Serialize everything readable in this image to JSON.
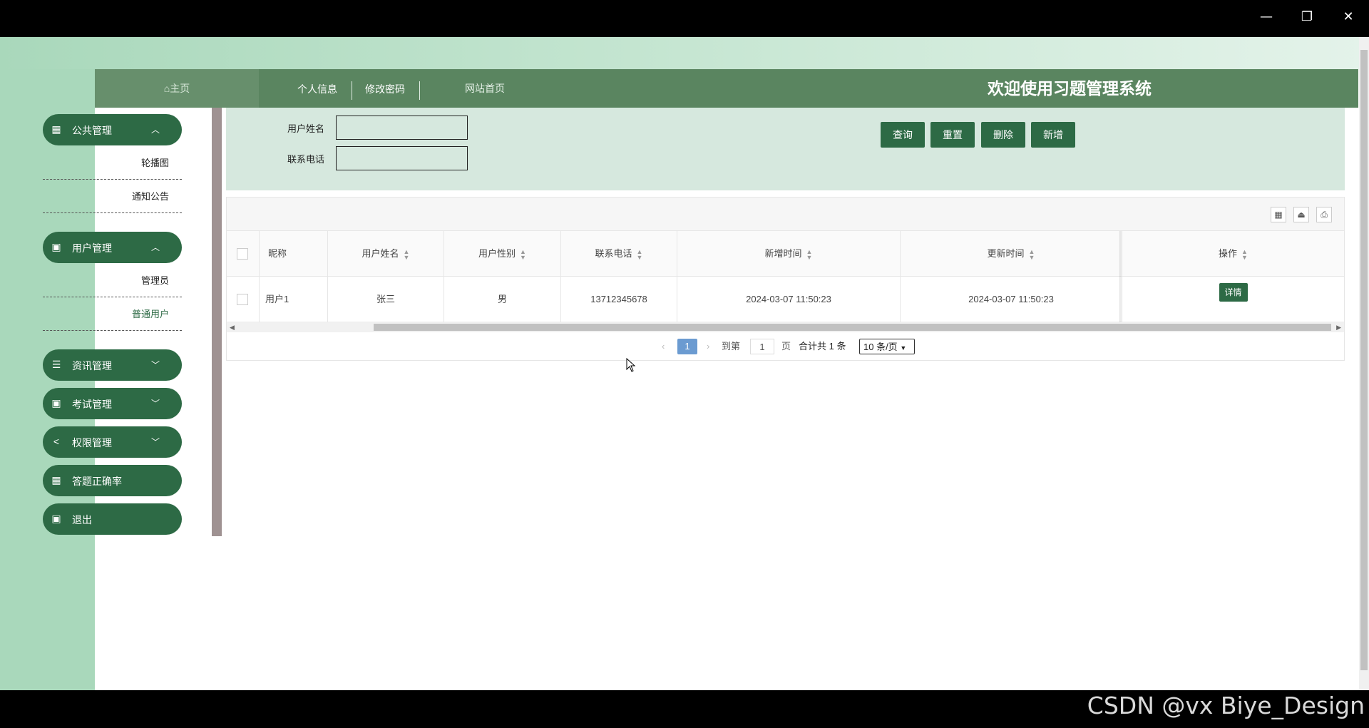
{
  "window": {
    "minimize": "—",
    "restore": "❐",
    "close": "✕"
  },
  "topnav": {
    "home": "主页",
    "home_icon": "home-icon",
    "personal_info": "个人信息",
    "change_password": "修改密码",
    "site_home": "网站首页",
    "system_title": "欢迎使用习题管理系统"
  },
  "sidebar": {
    "menus": [
      {
        "label": "公共管理",
        "icon": "grid-icon",
        "expanded": true,
        "children": [
          "轮播图",
          "通知公告"
        ]
      },
      {
        "label": "用户管理",
        "icon": "book-icon",
        "expanded": true,
        "children": [
          "管理员",
          "普通用户"
        ]
      },
      {
        "label": "资讯管理",
        "icon": "list-icon",
        "expanded": false
      },
      {
        "label": "考试管理",
        "icon": "book-icon",
        "expanded": false
      },
      {
        "label": "权限管理",
        "icon": "share-icon",
        "expanded": false
      },
      {
        "label": "答题正确率",
        "icon": "grid-icon"
      },
      {
        "label": "退出",
        "icon": "book-icon"
      }
    ]
  },
  "search": {
    "username_label": "用户姓名",
    "phone_label": "联系电话",
    "username_value": "",
    "phone_value": "",
    "buttons": {
      "query": "查询",
      "reset": "重置",
      "delete": "删除",
      "add": "新增"
    }
  },
  "table": {
    "toolbar_icons": [
      "columns-icon",
      "export-icon",
      "print-icon"
    ],
    "columns": [
      "昵称",
      "用户姓名",
      "用户性别",
      "联系电话",
      "新增时间",
      "更新时间",
      "操作"
    ],
    "rows": [
      {
        "nickname": "用户1",
        "name": "张三",
        "gender": "男",
        "phone": "13712345678",
        "created": "2024-03-07 11:50:23",
        "updated": "2024-03-07 11:50:23",
        "action": "详情"
      }
    ]
  },
  "pagination": {
    "current_page": "1",
    "goto_label": "到第",
    "goto_value": "1",
    "page_unit": "页",
    "total_text": "合计共 1 条",
    "page_size": "10 条/页"
  },
  "watermark": "CSDN @vx Biye_Design",
  "colors": {
    "primary": "#2d6a45",
    "nav": "#5a8560",
    "search_bg": "#d6e8de",
    "left_band": "#a9d8bb",
    "rail": "#9f9292"
  }
}
